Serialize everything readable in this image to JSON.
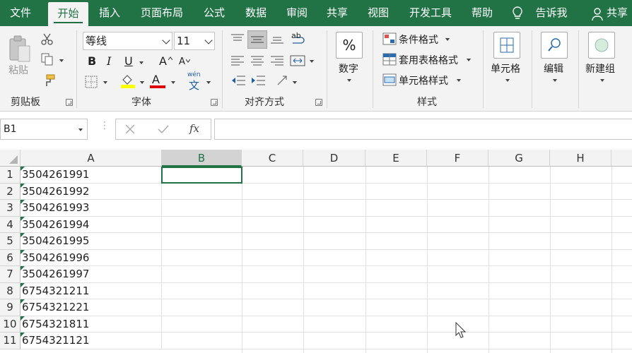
{
  "tabs": [
    "文件",
    "开始",
    "插入",
    "页面布局",
    "公式",
    "数据",
    "审阅",
    "共享",
    "视图",
    "开发工具",
    "帮助"
  ],
  "tell_me": "告诉我",
  "share": "共享",
  "clipboard": {
    "paste": "粘贴",
    "group": "剪贴板"
  },
  "font": {
    "name": "等线",
    "size": "11",
    "bold": "B",
    "italic": "I",
    "underline": "U",
    "grow": "A",
    "shrink": "A",
    "font_color": "A",
    "phonetic": "文",
    "phonetic_top": "wén",
    "group": "字体"
  },
  "alignment": {
    "group": "对齐方式",
    "wrap": "ab"
  },
  "number": {
    "label": "数字",
    "symbol": "%"
  },
  "styles": {
    "conditional": "条件格式",
    "table": "套用表格格式",
    "cell": "单元格样式",
    "group": "样式"
  },
  "cells": {
    "label": "单元格"
  },
  "editing": {
    "label": "编辑"
  },
  "newgroup": {
    "label": "新建组"
  },
  "formula_bar": {
    "name_box": "B1",
    "fx": "fx",
    "value": ""
  },
  "columns": [
    "A",
    "B",
    "C",
    "D",
    "E",
    "F",
    "G",
    "H"
  ],
  "rows": [
    {
      "num": "1",
      "a": "3504261991"
    },
    {
      "num": "2",
      "a": "3504261992"
    },
    {
      "num": "3",
      "a": "3504261993"
    },
    {
      "num": "4",
      "a": "3504261994"
    },
    {
      "num": "5",
      "a": "3504261995"
    },
    {
      "num": "6",
      "a": "3504261996"
    },
    {
      "num": "7",
      "a": "3504261997"
    },
    {
      "num": "8",
      "a": "6754321211"
    },
    {
      "num": "9",
      "a": "6754321221"
    },
    {
      "num": "10",
      "a": "6754321811"
    },
    {
      "num": "11",
      "a": "6754321121"
    }
  ],
  "colors": {
    "accent": "#217346",
    "highlight": "#ffff00",
    "font_red": "#e00000"
  }
}
